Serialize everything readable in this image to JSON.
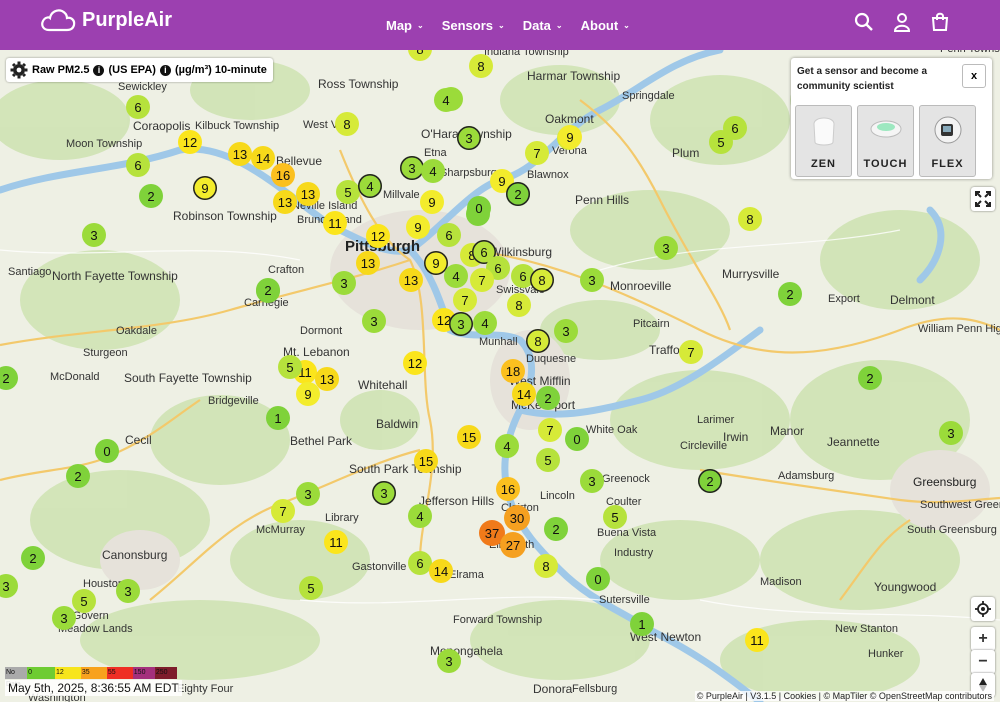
{
  "header": {
    "brand": "PurpleAir",
    "nav": [
      "Map",
      "Sensors",
      "Data",
      "About"
    ],
    "icons": [
      "search-icon",
      "user-icon",
      "cart-icon"
    ],
    "bg_color": "#9c40b0"
  },
  "controls": {
    "metric": "Raw PM2.5",
    "standard": "(US EPA)",
    "units": "(µg/m³) 10-minute"
  },
  "promo": {
    "text": "Get a sensor and become a community scientist",
    "close": "x",
    "products": [
      "ZEN",
      "TOUCH",
      "FLEX"
    ]
  },
  "legend": {
    "items": [
      {
        "label": "No Data",
        "color": "#aaaaaa"
      },
      {
        "label": "0",
        "color": "#6ecc32"
      },
      {
        "label": "12",
        "color": "#f7e51c"
      },
      {
        "label": "35",
        "color": "#f8a21e"
      },
      {
        "label": "55",
        "color": "#ef2f24"
      },
      {
        "label": "150",
        "color": "#a4307c"
      },
      {
        "label": "250",
        "color": "#7e1d2b"
      }
    ]
  },
  "timestamp": "May 5th, 2025, 8:36:55 AM EDT",
  "attribution": "© PurpleAir | V3.1.5 | Cookies | © MapTiler © OpenStreetMap contributors",
  "map": {
    "places": [
      "Pittsburgh",
      "Moon Township",
      "Coraopolis",
      "Sewickley",
      "Kilbuck Township",
      "Ross Township",
      "West View",
      "Bellevue",
      "Harmar Township",
      "Oakmont",
      "O'Hara Township",
      "Etna",
      "Sharpsburg",
      "Verona",
      "Plum",
      "Blawnox",
      "Penn Hills",
      "Millvale",
      "Robinson Township",
      "Crafton",
      "Wilkinsburg",
      "Santiago",
      "North Fayette Township",
      "Carnegie",
      "Monroeville",
      "Murrysville",
      "Export",
      "Delmont",
      "Swissvale",
      "Pitcairn",
      "Dormont",
      "Mt. Lebanon",
      "Oakdale",
      "Sturgeon",
      "South Fayette Township",
      "McDonald",
      "Bridgeville",
      "Whitehall",
      "Munhall",
      "Trafford",
      "Duquesne",
      "West Mifflin",
      "McKeesport",
      "Baldwin",
      "Cecil",
      "Bethel Park",
      "Larimer",
      "White Oak",
      "Irwin",
      "Manor",
      "Jeannette",
      "Circleville",
      "South Park Township",
      "Jefferson Hills",
      "Lincoln",
      "Clairton",
      "Greenock",
      "Adamsburg",
      "Greensburg",
      "Southwest Greensburg",
      "South Greensburg",
      "Library",
      "McMurray",
      "Coulter",
      "Buena Vista",
      "Canonsburg",
      "Elizabeth",
      "Gastonville",
      "Elrama",
      "Industry",
      "Madison",
      "Houston",
      "McGovern",
      "Meadow Lands",
      "Sutersville",
      "Youngwood",
      "Forward Township",
      "West Newton",
      "New Stanton",
      "Monongahela",
      "Hunker",
      "Donora",
      "Fellsburg",
      "Eighty Four",
      "Washington",
      "Springdale",
      "Penn Township",
      "Neville Island",
      "Brunot Island",
      "William Penn Highway",
      "Indiana Township"
    ],
    "sensors": [
      {
        "v": "8"
      },
      {
        "v": "8"
      },
      {
        "v": "8"
      },
      {
        "v": "4"
      },
      {
        "v": "6"
      },
      {
        "v": "12"
      },
      {
        "v": "13"
      },
      {
        "v": "14"
      },
      {
        "v": "6"
      },
      {
        "v": "9"
      },
      {
        "v": "16"
      },
      {
        "v": "8"
      },
      {
        "v": "3"
      },
      {
        "v": "13"
      },
      {
        "v": "5"
      },
      {
        "v": "4"
      },
      {
        "v": "3"
      },
      {
        "v": "4"
      },
      {
        "v": "9"
      },
      {
        "v": "7"
      },
      {
        "v": "9"
      },
      {
        "v": "6"
      },
      {
        "v": "5"
      },
      {
        "v": "2"
      },
      {
        "v": "9"
      },
      {
        "v": "2"
      },
      {
        "v": "13"
      },
      {
        "v": "11"
      },
      {
        "v": "12"
      },
      {
        "v": "9"
      },
      {
        "v": "0"
      },
      {
        "v": "6"
      },
      {
        "v": "13"
      },
      {
        "v": "8"
      },
      {
        "v": "6"
      },
      {
        "v": "6"
      },
      {
        "v": "9"
      },
      {
        "v": "4"
      },
      {
        "v": "7"
      },
      {
        "v": "6"
      },
      {
        "v": "8"
      },
      {
        "v": "13"
      },
      {
        "v": "7"
      },
      {
        "v": "12"
      },
      {
        "v": "3"
      },
      {
        "v": "4"
      },
      {
        "v": "8"
      },
      {
        "v": "8"
      },
      {
        "v": "3"
      },
      {
        "v": "8"
      },
      {
        "v": "3"
      },
      {
        "v": "3"
      },
      {
        "v": "2"
      },
      {
        "v": "3"
      },
      {
        "v": "2"
      },
      {
        "v": "7"
      },
      {
        "v": "11"
      },
      {
        "v": "5"
      },
      {
        "v": "12"
      },
      {
        "v": "13"
      },
      {
        "v": "9"
      },
      {
        "v": "1"
      },
      {
        "v": "18"
      },
      {
        "v": "14"
      },
      {
        "v": "2"
      },
      {
        "v": "4"
      },
      {
        "v": "7"
      },
      {
        "v": "0"
      },
      {
        "v": "5"
      },
      {
        "v": "15"
      },
      {
        "v": "15"
      },
      {
        "v": "0"
      },
      {
        "v": "2"
      },
      {
        "v": "2"
      },
      {
        "v": "3"
      },
      {
        "v": "16"
      },
      {
        "v": "30"
      },
      {
        "v": "37"
      },
      {
        "v": "27"
      },
      {
        "v": "2"
      },
      {
        "v": "8"
      },
      {
        "v": "3"
      },
      {
        "v": "5"
      },
      {
        "v": "4"
      },
      {
        "v": "7"
      },
      {
        "v": "3"
      },
      {
        "v": "11"
      },
      {
        "v": "6"
      },
      {
        "v": "14"
      },
      {
        "v": "2"
      },
      {
        "v": "3"
      },
      {
        "v": "5"
      },
      {
        "v": "3"
      },
      {
        "v": "5"
      },
      {
        "v": "0"
      },
      {
        "v": "1"
      },
      {
        "v": "3"
      },
      {
        "v": "11"
      },
      {
        "v": "2"
      },
      {
        "v": "3"
      },
      {
        "v": "3"
      },
      {
        "v": "3"
      },
      {
        "v": "0"
      },
      {
        "v": "2"
      },
      {
        "v": "3"
      },
      {
        "v": "2"
      },
      {
        "v": "4"
      }
    ]
  }
}
